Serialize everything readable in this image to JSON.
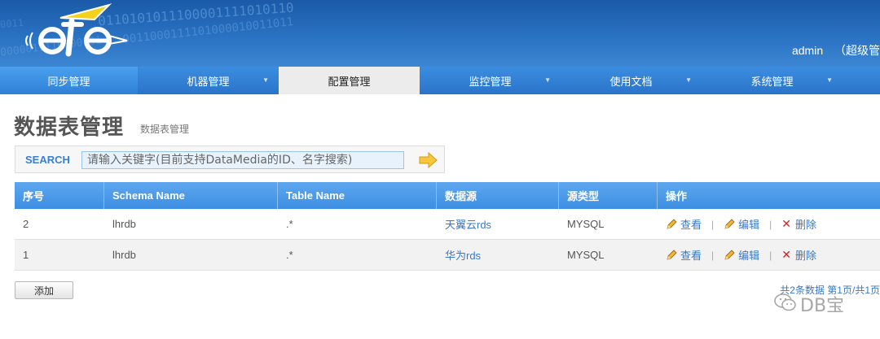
{
  "header": {
    "binary_lines": [
      "0110101011100001111010110",
      "0011000111101000010011011",
      "0000011110000101",
      "0011"
    ],
    "user": "admin",
    "role": "（超级管"
  },
  "nav": {
    "items": [
      {
        "label": "同步管理",
        "dropdown": false
      },
      {
        "label": "机器管理",
        "dropdown": true
      },
      {
        "label": "配置管理",
        "dropdown": false,
        "active": true
      },
      {
        "label": "监控管理",
        "dropdown": true
      },
      {
        "label": "使用文档",
        "dropdown": true
      },
      {
        "label": "系统管理",
        "dropdown": true
      }
    ],
    "caret": "▼"
  },
  "page": {
    "title": "数据表管理",
    "subtitle": "数据表管理"
  },
  "search": {
    "label": "SEARCH",
    "placeholder": "请输入关键字(目前支持DataMedia的ID、名字搜索)"
  },
  "table": {
    "headers": [
      "序号",
      "Schema Name",
      "Table Name",
      "数据源",
      "源类型",
      "操作"
    ],
    "rows": [
      {
        "id": "2",
        "schema": "lhrdb",
        "table": ".*",
        "source": "天翼云rds",
        "type": "MYSQL"
      },
      {
        "id": "1",
        "schema": "lhrdb",
        "table": ".*",
        "source": "华为rds",
        "type": "MYSQL"
      }
    ],
    "actions": {
      "view": "查看",
      "edit": "编辑",
      "delete": "删除",
      "sep": "|"
    }
  },
  "footer": {
    "add_label": "添加",
    "pager": "共2条数据  第1页/共1页"
  },
  "watermark": {
    "text": "DB宝"
  },
  "colors": {
    "accent": "#3a78c8",
    "header": "#1a5aa8",
    "delete": "#d0211c"
  }
}
